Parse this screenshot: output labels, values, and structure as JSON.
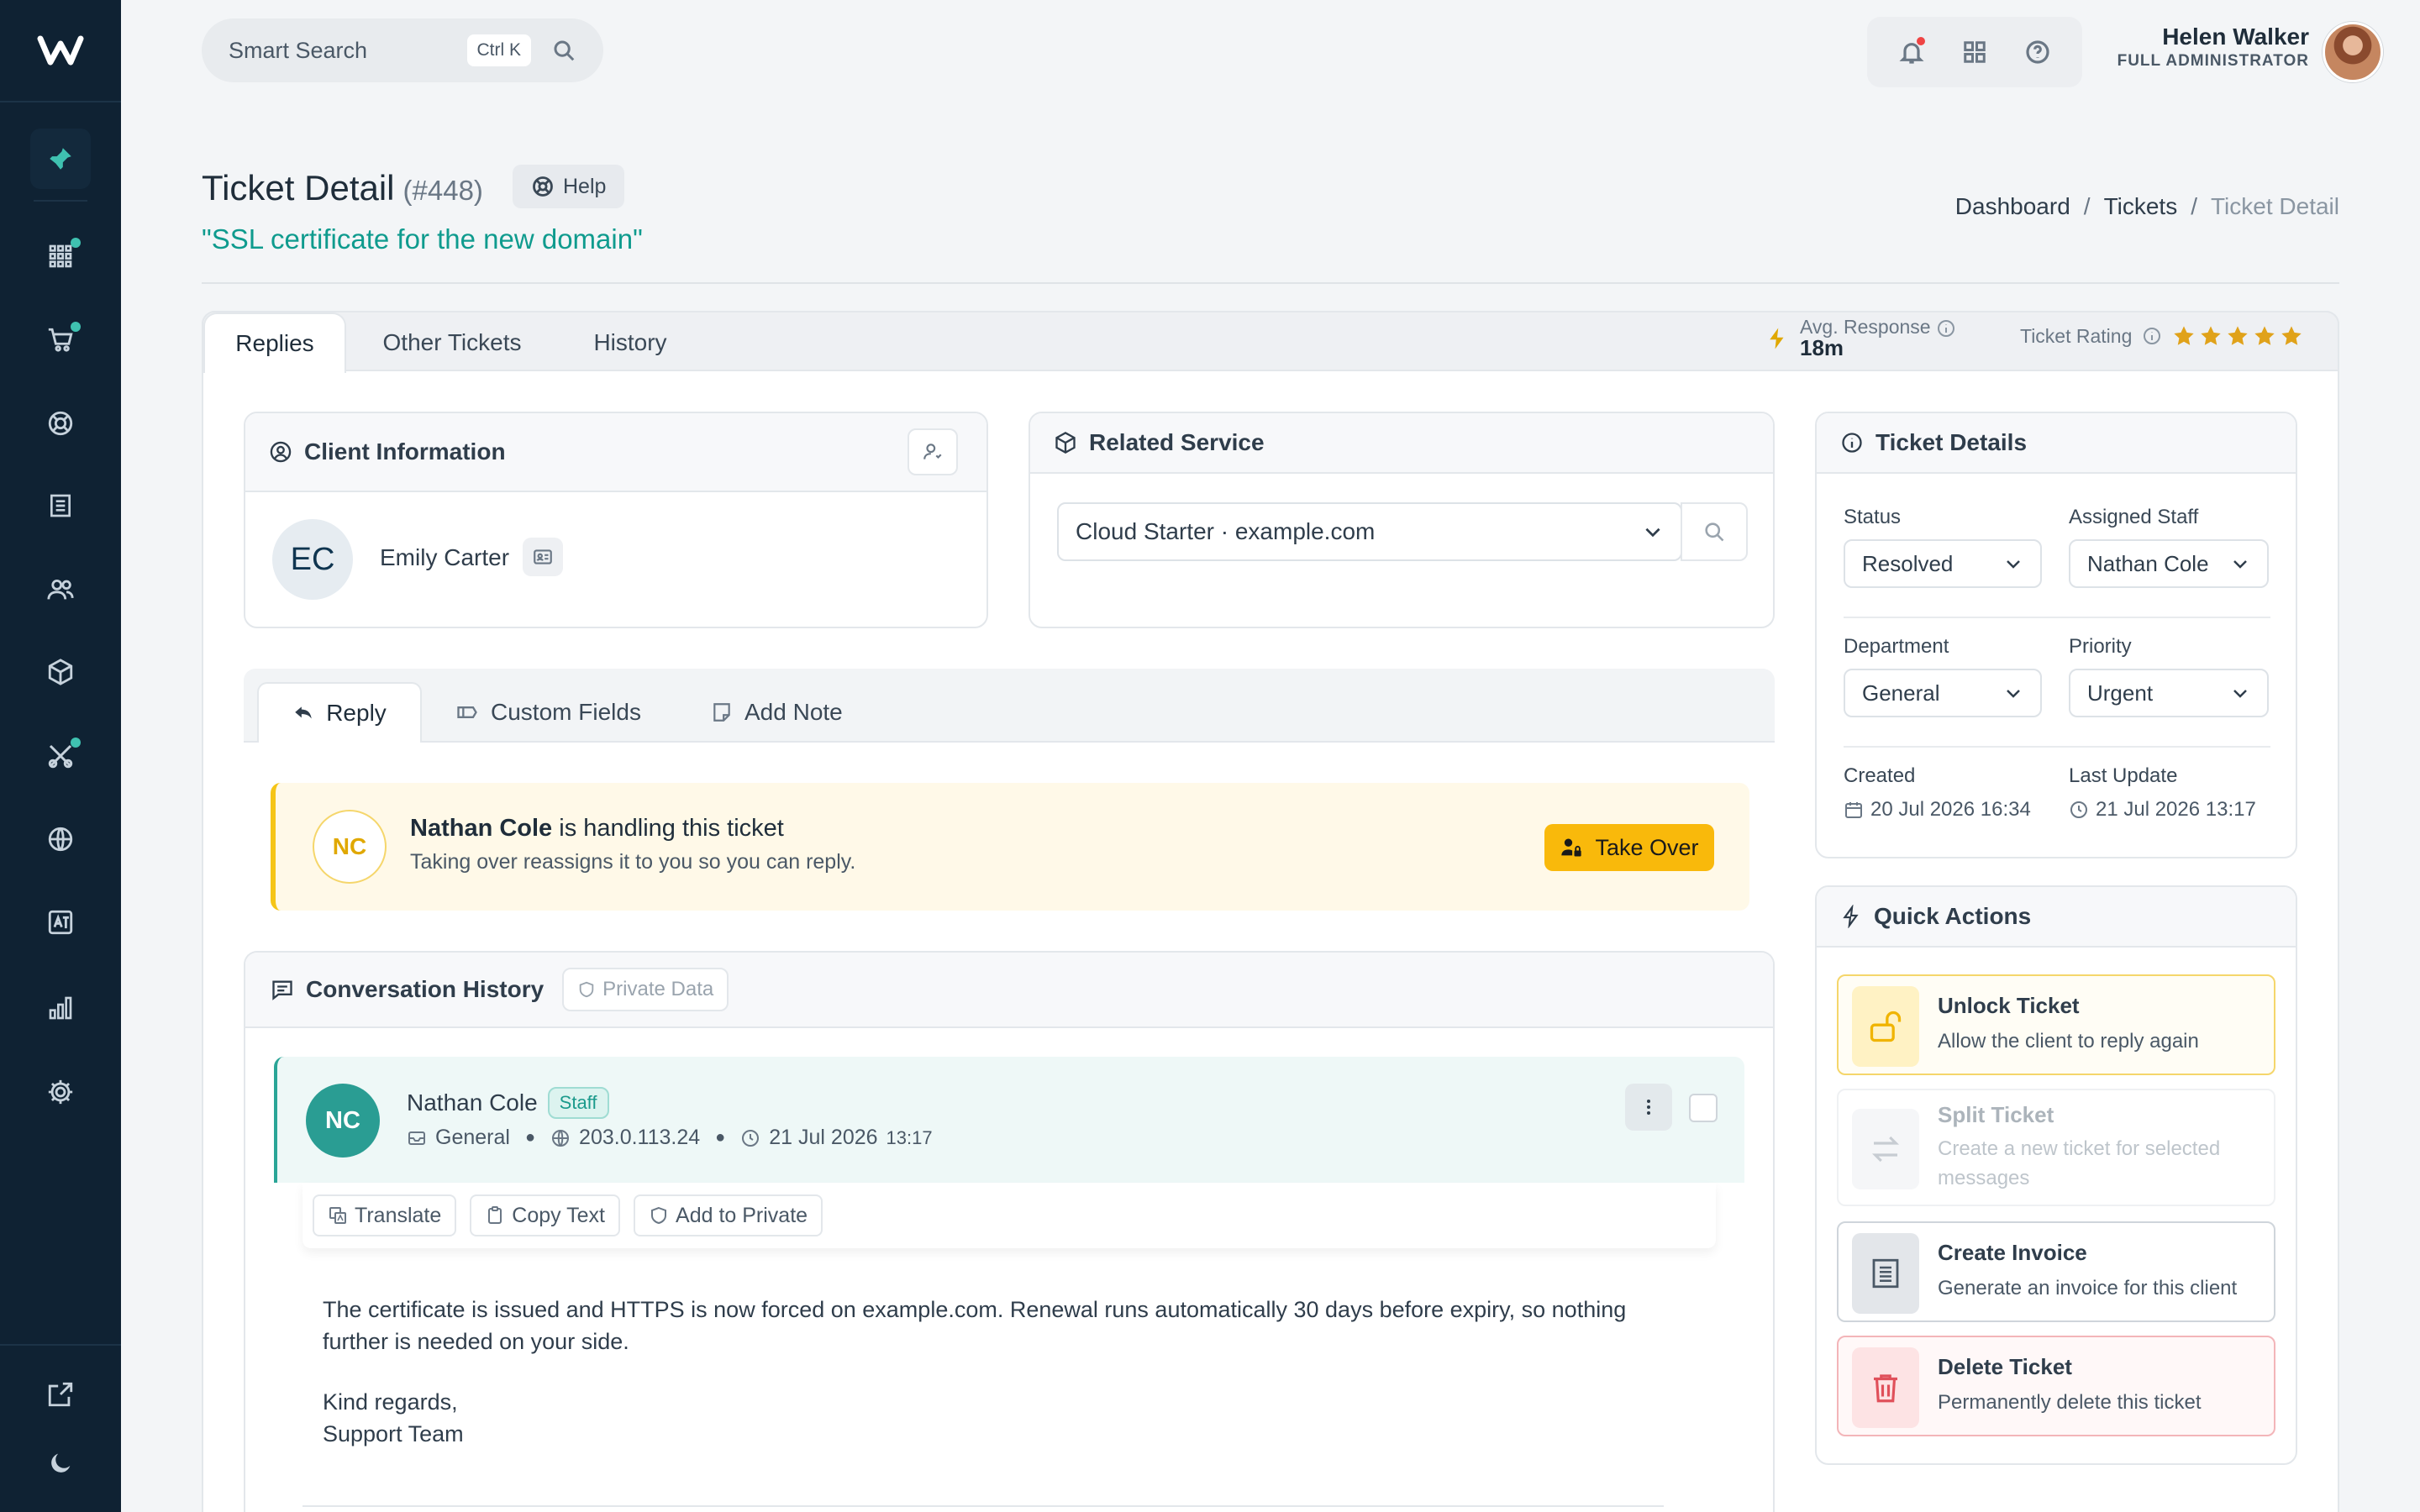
{
  "search": {
    "placeholder": "Smart Search",
    "shortcut": "Ctrl K"
  },
  "user": {
    "name": "Helen Walker",
    "role": "FULL ADMINISTRATOR"
  },
  "page": {
    "title": "Ticket Detail",
    "number": "(#448)",
    "help_label": "Help",
    "subtitle": "\"SSL certificate for the new domain\""
  },
  "breadcrumb": {
    "items": [
      "Dashboard",
      "Tickets",
      "Ticket Detail"
    ]
  },
  "tabs": [
    "Replies",
    "Other Tickets",
    "History"
  ],
  "stats": {
    "avg_response_label": "Avg. Response",
    "avg_response_value": "18m",
    "rating_label": "Ticket Rating",
    "rating_stars": 5
  },
  "client": {
    "header": "Client Information",
    "initials": "EC",
    "name": "Emily Carter"
  },
  "service": {
    "header": "Related Service",
    "selected": "Cloud Starter · example.com"
  },
  "details": {
    "header": "Ticket Details",
    "status_label": "Status",
    "status_value": "Resolved",
    "staff_label": "Assigned Staff",
    "staff_value": "Nathan Cole",
    "department_label": "Department",
    "department_value": "General",
    "priority_label": "Priority",
    "priority_value": "Urgent",
    "created_label": "Created",
    "created_value": "20 Jul 2026 16:34",
    "updated_label": "Last Update",
    "updated_value": "21 Jul 2026 13:17"
  },
  "subtabs": [
    "Reply",
    "Custom Fields",
    "Add Note"
  ],
  "notice": {
    "initials": "NC",
    "name": "Nathan Cole",
    "text": " is handling this ticket",
    "sub": "Taking over reassigns it to you so you can reply.",
    "button": "Take Over"
  },
  "conversation": {
    "header": "Conversation History",
    "private_badge": "Private Data",
    "message": {
      "initials": "NC",
      "author": "Nathan Cole",
      "badge": "Staff",
      "department": "General",
      "ip": "203.0.113.24",
      "date": "21 Jul 2026",
      "time": "13:17",
      "actions": [
        "Translate",
        "Copy Text",
        "Add to Private"
      ],
      "body1": "The certificate is issued and HTTPS is now forced on example.com. Renewal runs automatically 30 days before expiry, so nothing further is needed on your side.",
      "body2": "Kind regards,",
      "body3": "Support Team"
    }
  },
  "quick_actions": {
    "header": "Quick Actions",
    "items": [
      {
        "title": "Unlock Ticket",
        "desc": "Allow the client to reply again"
      },
      {
        "title": "Split Ticket",
        "desc": "Create a new ticket for selected messages"
      },
      {
        "title": "Create Invoice",
        "desc": "Generate an invoice for this client"
      },
      {
        "title": "Delete Ticket",
        "desc": "Permanently delete this ticket"
      }
    ]
  },
  "colors": {
    "sidebar": "#0f2233",
    "accent": "#0f9b8e",
    "warning": "#f9b90b",
    "danger": "#e0505a"
  }
}
